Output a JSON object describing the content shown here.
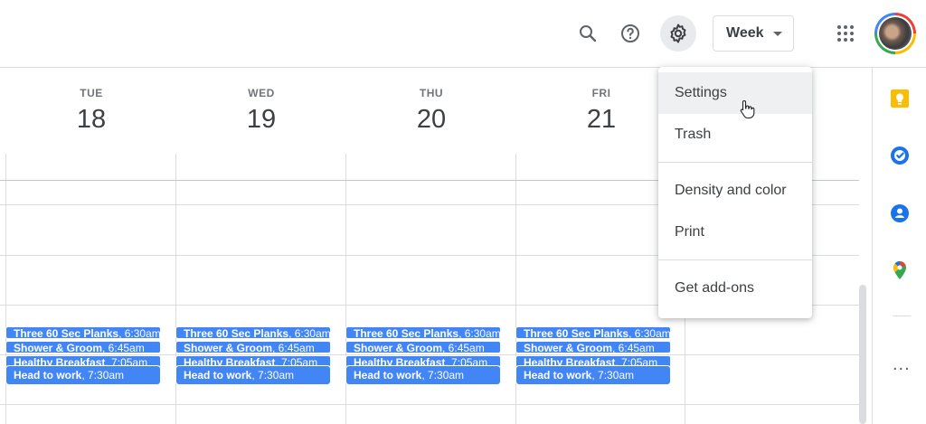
{
  "header": {
    "view_select": {
      "label": "Week"
    },
    "icons": [
      "search-icon",
      "help-icon",
      "gear-icon",
      "apps-grid-icon"
    ]
  },
  "days": [
    {
      "dow": "TUE",
      "date": "18"
    },
    {
      "dow": "WED",
      "date": "19"
    },
    {
      "dow": "THU",
      "date": "20"
    },
    {
      "dow": "FRI",
      "date": "21"
    }
  ],
  "events": [
    {
      "title": "Three 60 Sec Planks",
      "time": ", 6:30am"
    },
    {
      "title": "Shower & Groom",
      "time": ", 6:45am"
    },
    {
      "title": "Healthy Breakfast",
      "time": ", 7:05am"
    },
    {
      "title": "Head to work",
      "time": ", 7:30am"
    }
  ],
  "menu": {
    "items": [
      {
        "label": "Settings"
      },
      {
        "label": "Trash"
      },
      {
        "label": "Density and color"
      },
      {
        "label": "Print"
      },
      {
        "label": "Get add-ons"
      }
    ]
  },
  "side_panel": {
    "icons": [
      "keep-icon",
      "tasks-icon",
      "contacts-icon",
      "maps-icon",
      "more-icon"
    ],
    "more_label": "..."
  },
  "colors": {
    "event": "#4285f4",
    "accent_yellow": "#fbbc04",
    "accent_blue": "#1a73e8"
  }
}
